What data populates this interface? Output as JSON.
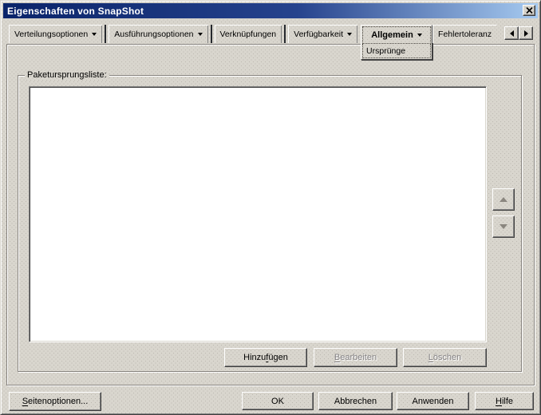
{
  "window": {
    "title": "Eigenschaften von SnapShot"
  },
  "icons": {
    "close": "x-cross",
    "tab_dropdown": "black triangle down",
    "tab_scroll_left": "black triangle left",
    "tab_scroll_right": "black triangle right",
    "move_up": "gray triangle up (disabled)",
    "move_down": "gray triangle down (disabled)"
  },
  "tabs": {
    "items": [
      {
        "label": "Verteilungsoptionen",
        "has_dropdown": true,
        "active": false
      },
      {
        "label": "Ausführungsoptionen",
        "has_dropdown": true,
        "active": false
      },
      {
        "label": "Verknüpfungen",
        "has_dropdown": false,
        "active": false
      },
      {
        "label": "Verfügbarkeit",
        "has_dropdown": true,
        "active": false
      },
      {
        "label": "Allgemein",
        "has_dropdown": true,
        "active": true,
        "sub_label": "Ursprünge"
      },
      {
        "label": "Fehlertoleranz",
        "has_dropdown": false,
        "active": false,
        "truncated": true
      }
    ]
  },
  "page": {
    "group_label": "Paketursprungsliste:",
    "list": {
      "items": []
    },
    "buttons": {
      "add": {
        "pre": "Hinzu",
        "accel": "f",
        "post": "ügen",
        "enabled": true
      },
      "edit": {
        "pre": "",
        "accel": "B",
        "post": "earbeiten",
        "enabled": false
      },
      "delete": {
        "pre": "",
        "accel": "L",
        "post": "öschen",
        "enabled": false
      }
    }
  },
  "footer": {
    "page_options": {
      "pre": "",
      "accel": "S",
      "post": "eitenoptionen..."
    },
    "ok": "OK",
    "cancel": "Abbrechen",
    "apply": "Anwenden",
    "help": {
      "pre": "",
      "accel": "H",
      "post": "ilfe"
    }
  },
  "colors": {
    "titlebar_start": "#0A246A",
    "titlebar_end": "#A6CAF0",
    "face": "#D9D6CE",
    "disabled_text": "#848284"
  }
}
